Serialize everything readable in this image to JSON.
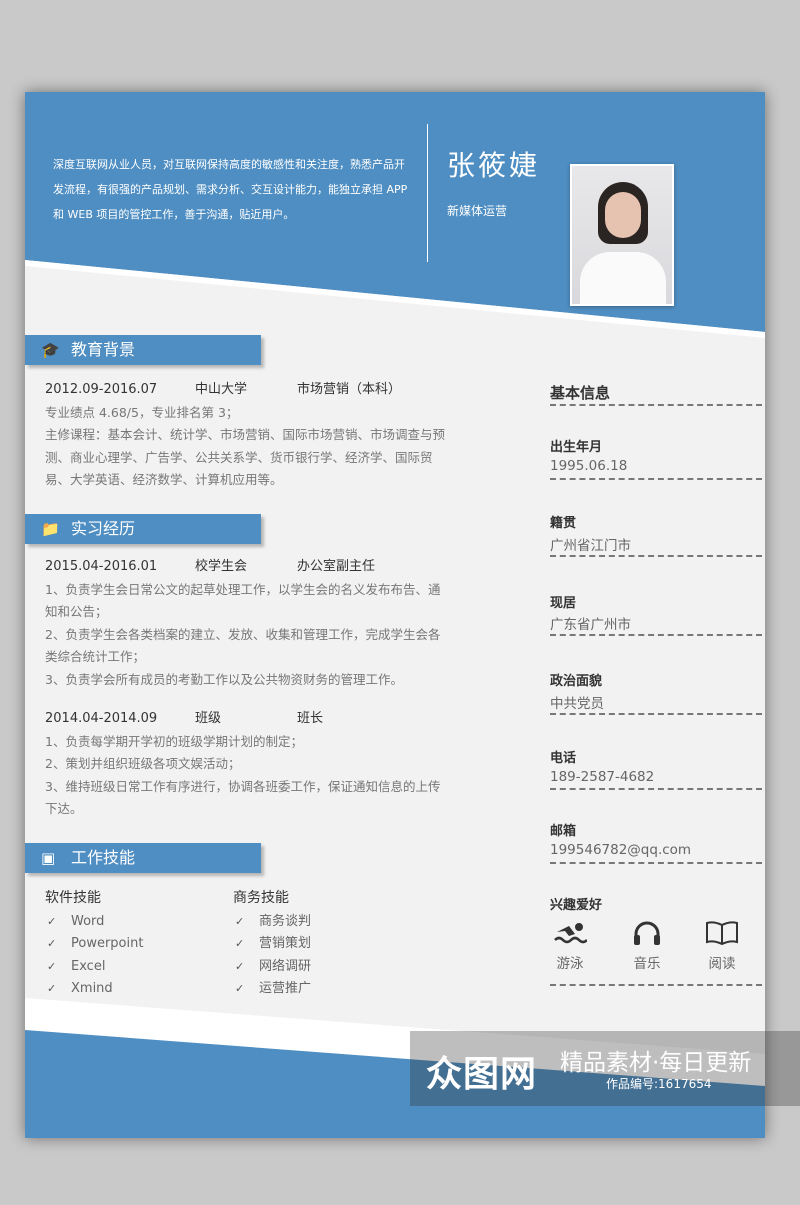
{
  "header": {
    "intro": "深度互联网从业人员，对互联网保持高度的敏感性和关注度，熟悉产品开发流程，有很强的产品规划、需求分析、交互设计能力，能独立承担 APP 和 WEB 项目的管控工作，善于沟通，贴近用户。",
    "name": "张筱婕",
    "role": "新媒体运营"
  },
  "education": {
    "title": "教育背景",
    "icon": "graduation-cap-icon",
    "period": "2012.09-2016.07",
    "school": "中山大学",
    "major": "市场营销（本科）",
    "lines": [
      "专业绩点 4.68/5，专业排名第 3；",
      "主修课程：基本会计、统计学、市场营销、国际市场营销、市场调查与预测、商业心理学、广告学、公共关系学、货币银行学、经济学、国际贸易、大学英语、经济数学、计算机应用等。"
    ]
  },
  "internship": {
    "title": "实习经历",
    "icon": "folder-icon",
    "jobs": [
      {
        "period": "2015.04-2016.01",
        "org": "校学生会",
        "position": "办公室副主任",
        "lines": [
          "1、负责学生会日常公文的起草处理工作，以学生会的名义发布布告、通知和公告；",
          "2、负责学生会各类档案的建立、发放、收集和管理工作，完成学生会各类综合统计工作；",
          "3、负责学会所有成员的考勤工作以及公共物资财务的管理工作。"
        ]
      },
      {
        "period": "2014.04-2014.09",
        "org": "班级",
        "position": "班长",
        "lines": [
          "1、负责每学期开学初的班级学期计划的制定；",
          "2、策划并组织班级各项文娱活动；",
          "3、维持班级日常工作有序进行，协调各班委工作，保证通知信息的上传下达。"
        ]
      }
    ]
  },
  "skills": {
    "title": "工作技能",
    "icon": "presentation-icon",
    "software": {
      "title": "软件技能",
      "items": [
        "Word",
        "Powerpoint",
        "Excel",
        "Xmind"
      ]
    },
    "business": {
      "title": "商务技能",
      "items": [
        "商务谈判",
        "营销策划",
        "网络调研",
        "运营推广"
      ]
    }
  },
  "info": {
    "title": "基本信息",
    "fields": [
      {
        "label": "出生年月",
        "value": "1995.06.18"
      },
      {
        "label": "籍贯",
        "value": "广州省江门市"
      },
      {
        "label": "现居",
        "value": "广东省广州市"
      },
      {
        "label": "政治面貌",
        "value": "中共党员"
      },
      {
        "label": "电话",
        "value": "189-2587-4682"
      },
      {
        "label": "邮箱",
        "value": "199546782@qq.com"
      }
    ],
    "hobby_title": "兴趣爱好",
    "hobbies": [
      {
        "label": "游泳",
        "icon": "swimming-icon"
      },
      {
        "label": "音乐",
        "icon": "headphones-icon"
      },
      {
        "label": "阅读",
        "icon": "book-icon"
      }
    ]
  },
  "watermark": {
    "logo": "众图网",
    "slogan": "精品素材·每日更新",
    "code": "作品编号:1617654"
  },
  "colors": {
    "accent": "#4f8ec2",
    "background": "#f2f2f2"
  }
}
